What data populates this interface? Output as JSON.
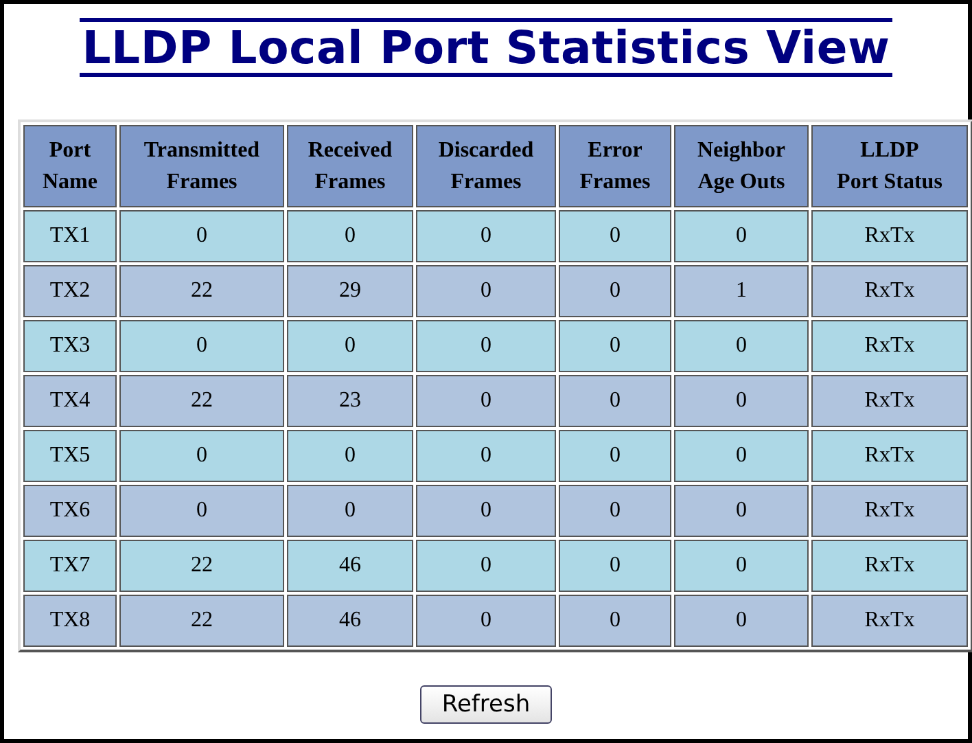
{
  "title": "LLDP Local Port Statistics View",
  "table": {
    "columns": [
      "Port\nName",
      "Transmitted\nFrames",
      "Received\nFrames",
      "Discarded\nFrames",
      "Error\nFrames",
      "Neighbor\nAge Outs",
      "LLDP\nPort Status"
    ],
    "rows": [
      [
        "TX1",
        "0",
        "0",
        "0",
        "0",
        "0",
        "RxTx"
      ],
      [
        "TX2",
        "22",
        "29",
        "0",
        "0",
        "1",
        "RxTx"
      ],
      [
        "TX3",
        "0",
        "0",
        "0",
        "0",
        "0",
        "RxTx"
      ],
      [
        "TX4",
        "22",
        "23",
        "0",
        "0",
        "0",
        "RxTx"
      ],
      [
        "TX5",
        "0",
        "0",
        "0",
        "0",
        "0",
        "RxTx"
      ],
      [
        "TX6",
        "0",
        "0",
        "0",
        "0",
        "0",
        "RxTx"
      ],
      [
        "TX7",
        "22",
        "46",
        "0",
        "0",
        "0",
        "RxTx"
      ],
      [
        "TX8",
        "22",
        "46",
        "0",
        "0",
        "0",
        "RxTx"
      ]
    ]
  },
  "buttons": [
    "Refresh"
  ]
}
